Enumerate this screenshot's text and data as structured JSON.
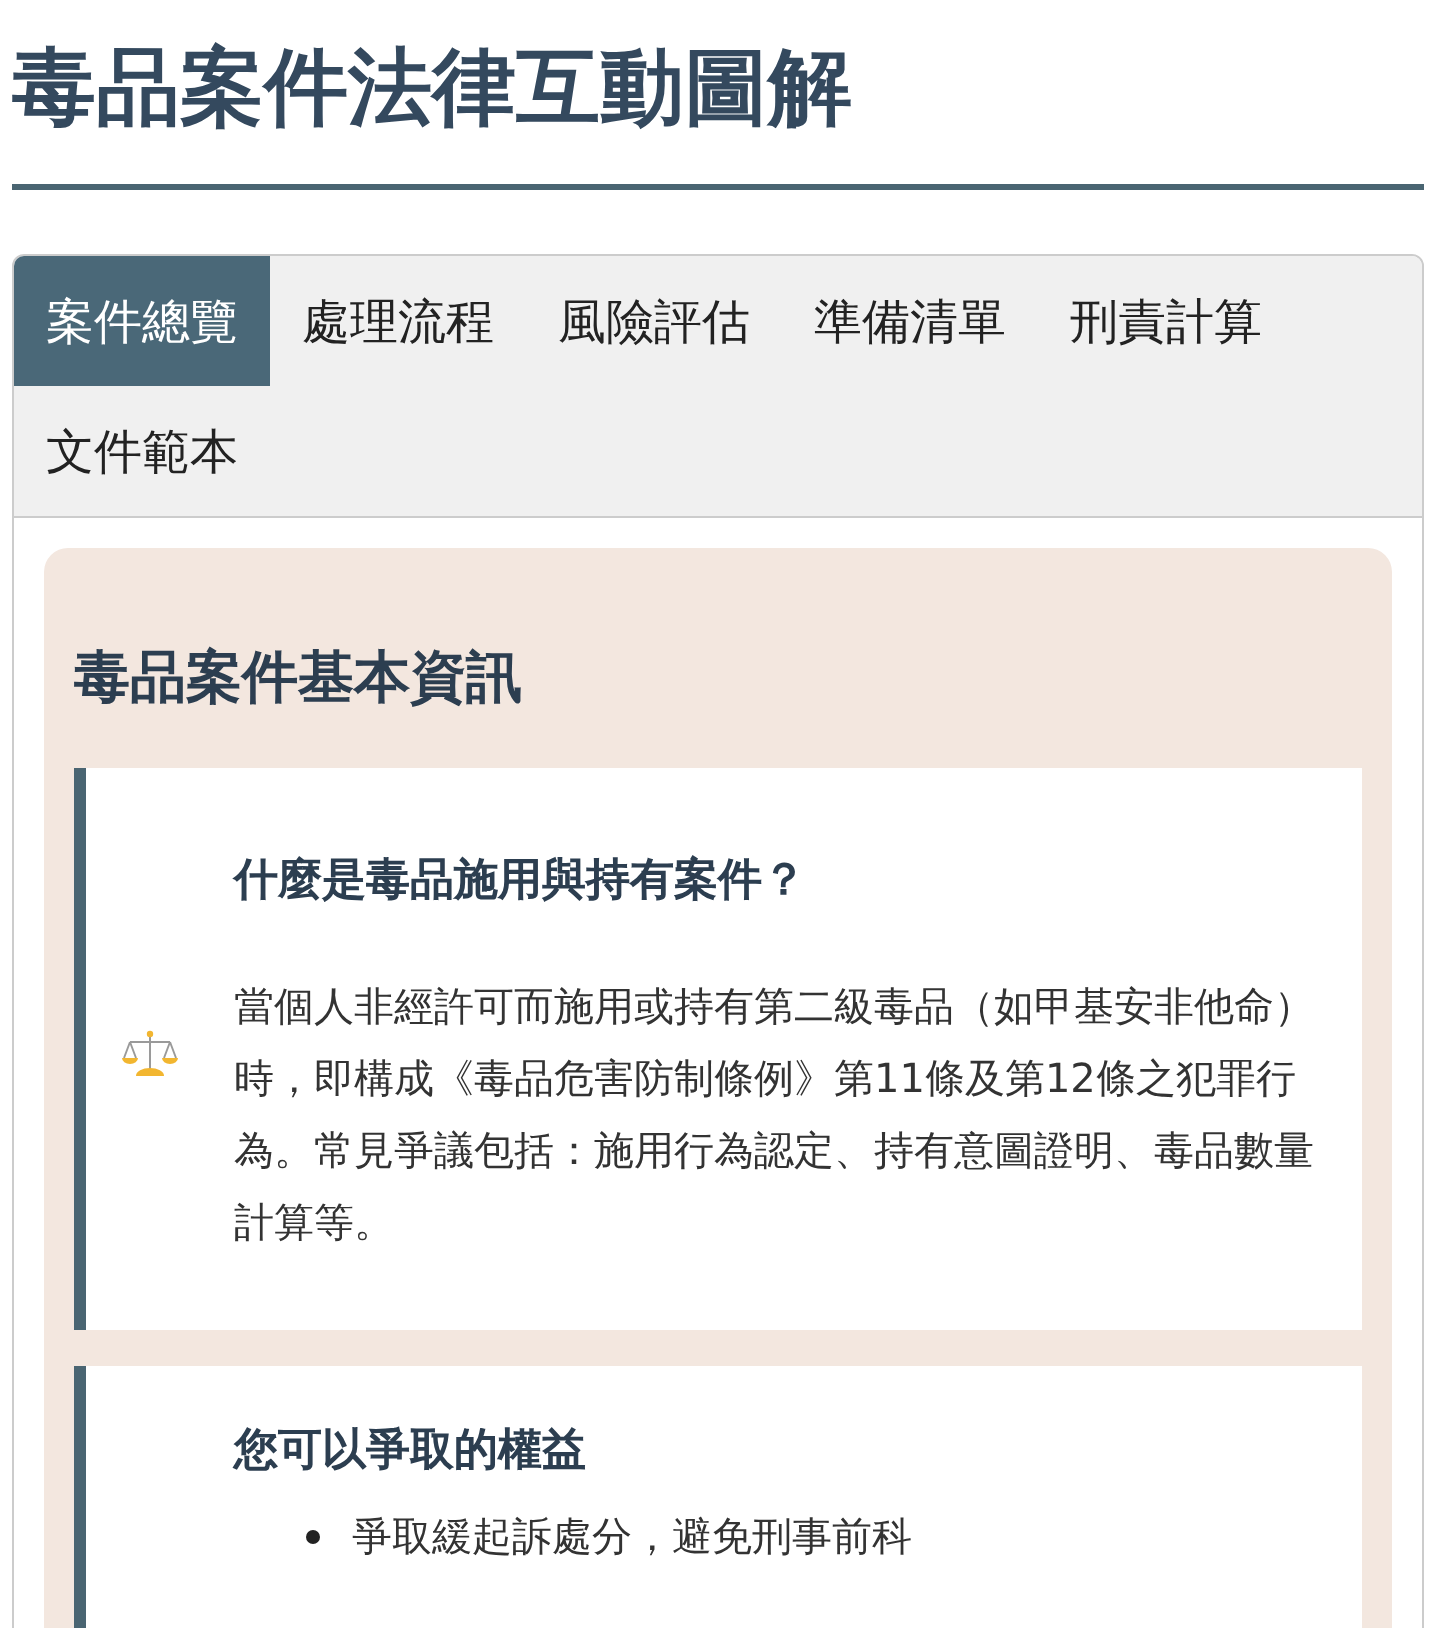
{
  "title": "毒品案件法律互動圖解",
  "tabs": [
    {
      "label": "案件總覽",
      "selected": true
    },
    {
      "label": "處理流程",
      "selected": false
    },
    {
      "label": "風險評估",
      "selected": false
    },
    {
      "label": "準備清單",
      "selected": false
    },
    {
      "label": "刑責計算",
      "selected": false
    },
    {
      "label": "文件範本",
      "selected": false
    }
  ],
  "section": {
    "heading": "毒品案件基本資訊",
    "cards": [
      {
        "kind": "text",
        "icon": true,
        "heading": "什麼是毒品施用與持有案件？",
        "body": "當個人非經許可而施用或持有第二級毒品（如甲基安非他命）時，即構成《毒品危害防制條例》第11條及第12條之犯罪行為。常見爭議包括：施用行為認定、持有意圖證明、毒品數量計算等。"
      },
      {
        "kind": "list",
        "icon": false,
        "heading": "您可以爭取的權益",
        "items": [
          "爭取緩起訴處分，避免刑事前科"
        ]
      }
    ]
  }
}
